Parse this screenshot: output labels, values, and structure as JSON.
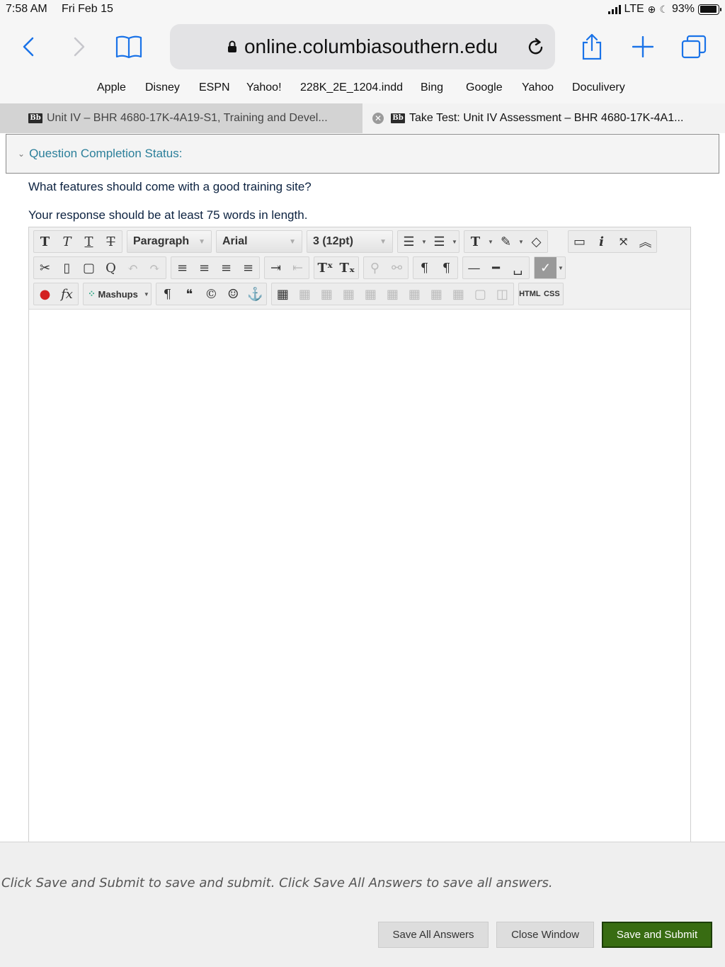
{
  "status_bar": {
    "time": "7:58 AM",
    "date": "Fri Feb 15",
    "network": "LTE",
    "battery": "93%",
    "battery_level": 0.93
  },
  "browser": {
    "url": "online.columbiasouthern.edu",
    "favorites": [
      "Apple",
      "Disney",
      "ESPN",
      "Yahoo!",
      "228K_2E_1204.indd",
      "Bing",
      "Google",
      "Yahoo",
      "Doculivery"
    ],
    "tabs": [
      {
        "title": "Unit IV – BHR 4680-17K-4A19-S1, Training and Devel...",
        "active": false
      },
      {
        "title": "Take Test: Unit IV Assessment – BHR 4680-17K-4A1...",
        "active": true
      }
    ]
  },
  "page": {
    "completion_status": "Question Completion Status:",
    "question": "What features should come with a good training site?",
    "requirement": "Your response should be at least 75 words in length."
  },
  "editor": {
    "format_select": "Paragraph",
    "font_select": "Arial",
    "size_select": "3 (12pt)",
    "mashups_label": "Mashups",
    "html_label": "HTML",
    "css_label": "CSS"
  },
  "footer": {
    "instructions": "Click Save and Submit to save and submit. Click Save All Answers to save all answers.",
    "save_all_label": "Save All Answers",
    "close_label": "Close Window",
    "submit_label": "Save and Submit"
  },
  "colors": {
    "accent_link": "#2b7f9a",
    "submit_green": "#386c12",
    "ios_blue": "#1a73e8"
  }
}
